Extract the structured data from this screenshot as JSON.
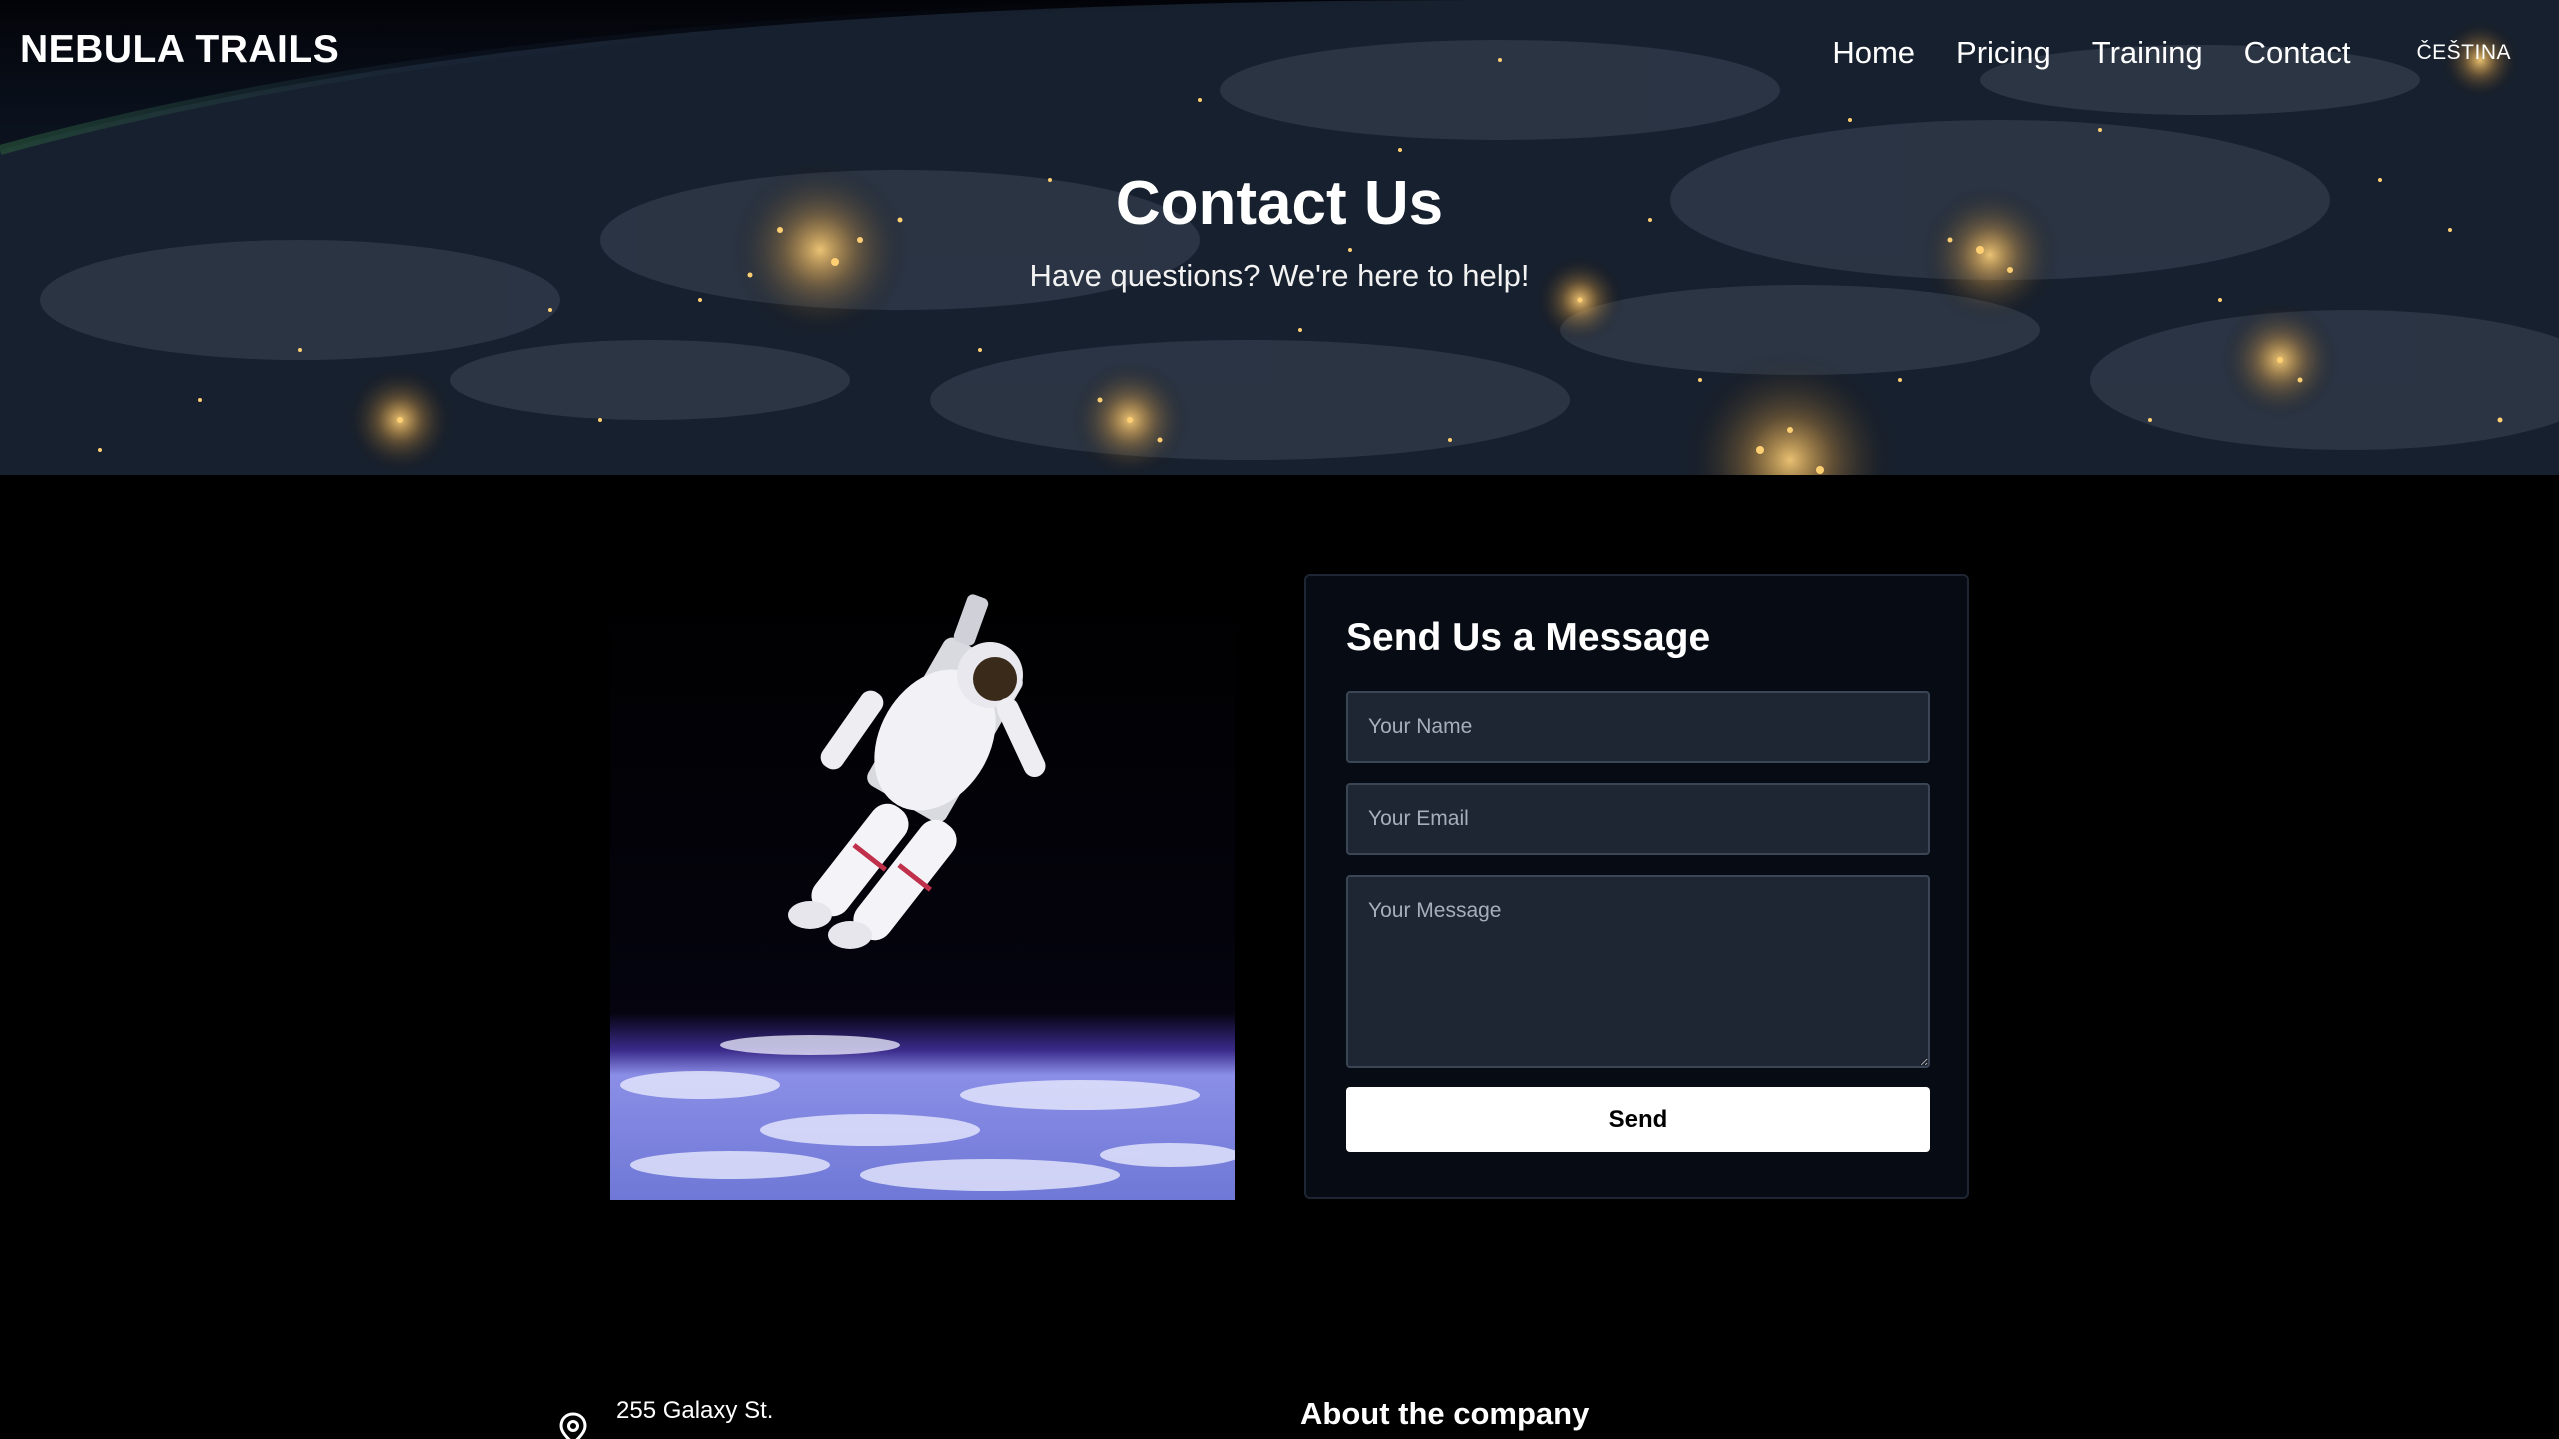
{
  "header": {
    "logo": "NEBULA TRAILS",
    "nav": [
      {
        "label": "Home"
      },
      {
        "label": "Pricing"
      },
      {
        "label": "Training"
      },
      {
        "label": "Contact"
      }
    ],
    "language_label": "ČEŠTINA"
  },
  "hero": {
    "title": "Contact Us",
    "subtitle": "Have questions? We're here to help!"
  },
  "contact_form": {
    "heading": "Send Us a Message",
    "name_placeholder": "Your Name",
    "email_placeholder": "Your Email",
    "message_placeholder": "Your Message",
    "send_label": "Send"
  },
  "footer": {
    "address_line": "255 Galaxy St.",
    "about_heading": "About the company"
  },
  "icons": {
    "location": "location-pin-icon"
  },
  "colors": {
    "background": "#000000",
    "card": "#070b13",
    "input": "#1e2633",
    "button": "#ffffff"
  }
}
